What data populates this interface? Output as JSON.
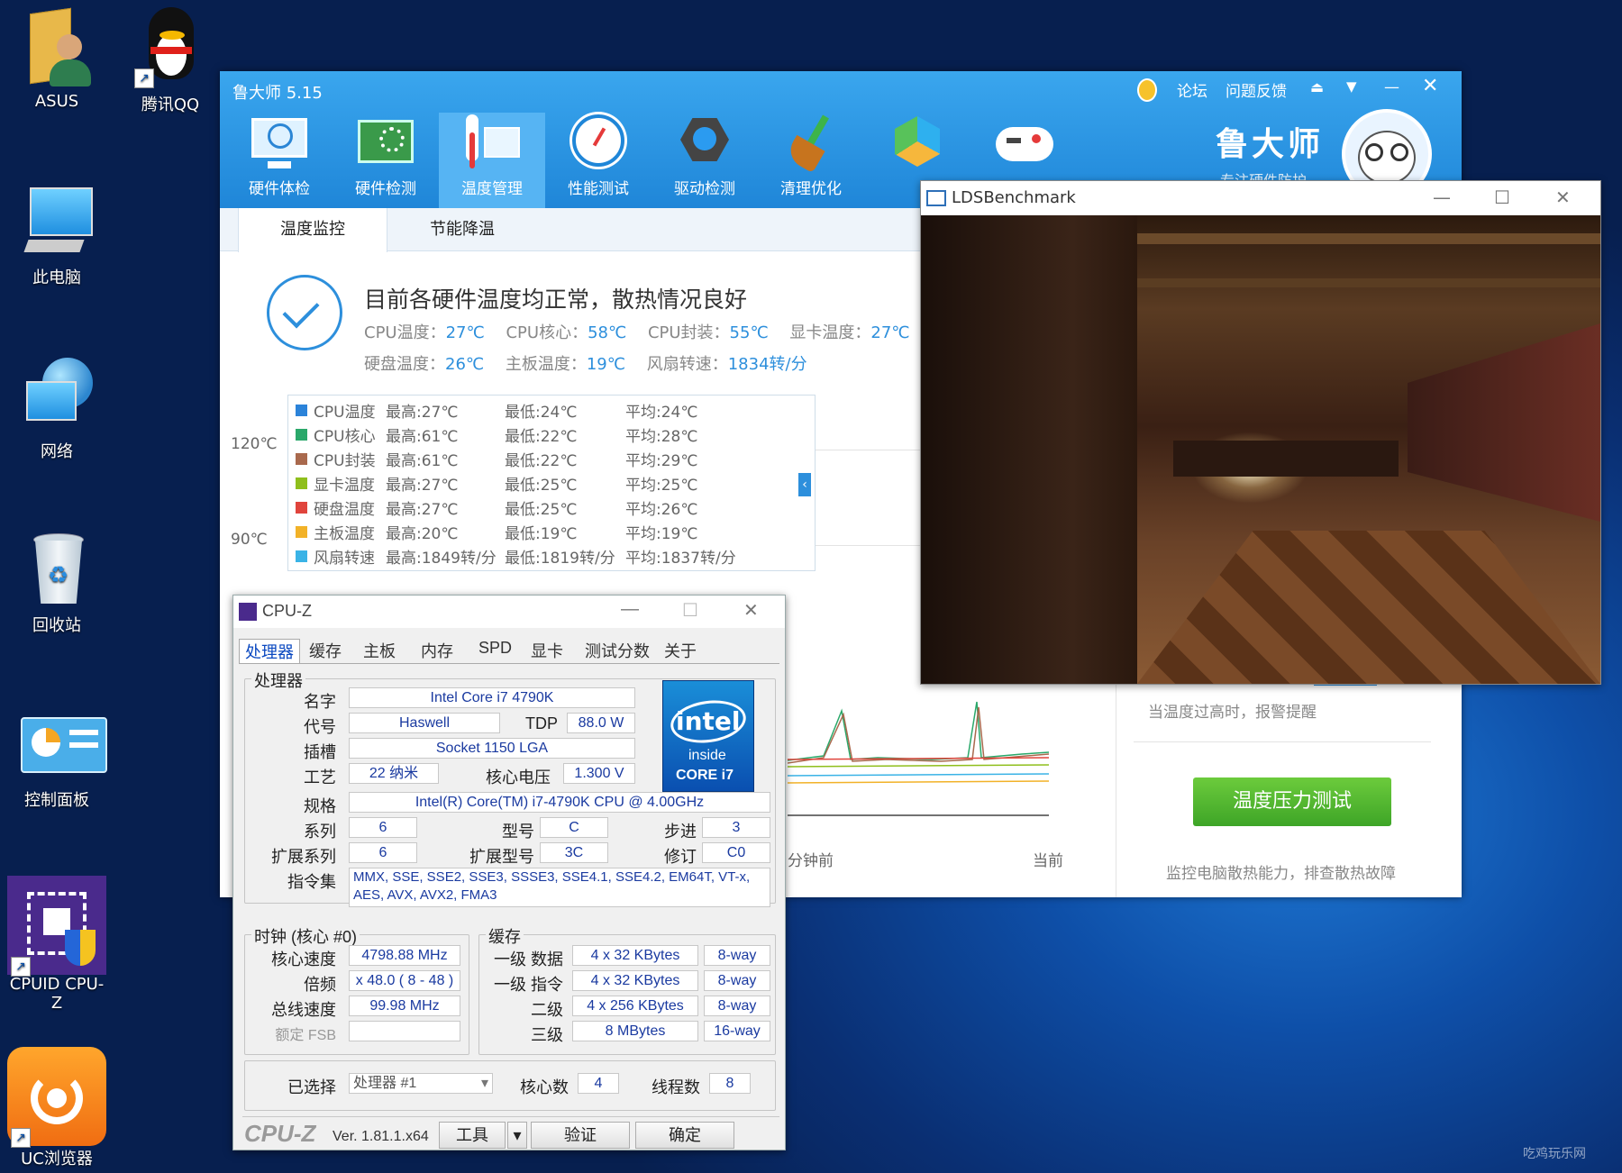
{
  "desktop": {
    "icons": [
      {
        "label": "ASUS",
        "icon": "user-folder-icon"
      },
      {
        "label": "腾讯QQ",
        "icon": "qq-penguin-icon"
      },
      {
        "label": "此电脑",
        "icon": "computer-icon"
      },
      {
        "label": "网络",
        "icon": "network-globe-icon"
      },
      {
        "label": "回收站",
        "icon": "recycle-bin-icon"
      },
      {
        "label": "控制面板",
        "icon": "control-panel-icon"
      },
      {
        "label": "CPUID CPU-Z",
        "icon": "cpu-chip-icon"
      },
      {
        "label": "UC浏览器",
        "icon": "uc-browser-icon"
      }
    ],
    "watermark": "吃鸡玩乐网"
  },
  "ludashi": {
    "title": "鲁大师 5.15",
    "top_links": [
      "论坛",
      "问题反馈"
    ],
    "nav": [
      {
        "label": "硬件体检",
        "icon": "monitor-check-icon"
      },
      {
        "label": "硬件检测",
        "icon": "hardware-board-icon"
      },
      {
        "label": "温度管理",
        "icon": "thermometer-icon"
      },
      {
        "label": "性能测试",
        "icon": "speedometer-icon"
      },
      {
        "label": "驱动检测",
        "icon": "gear-driver-icon"
      },
      {
        "label": "清理优化",
        "icon": "broom-icon"
      },
      {
        "label": "",
        "icon": "cube-icon"
      },
      {
        "label": "",
        "icon": "gamepad-icon"
      }
    ],
    "brand": "鲁大师",
    "brand_sub": "专注硬件防护",
    "subtabs": [
      "温度监控",
      "节能降温"
    ],
    "status_title": "目前各硬件温度均正常，散热情况良好",
    "metrics_row1": [
      {
        "label": "CPU温度：",
        "value": "27℃"
      },
      {
        "label": "CPU核心：",
        "value": "58℃"
      },
      {
        "label": "CPU封装：",
        "value": "55℃"
      },
      {
        "label": "显卡温度：",
        "value": "27℃"
      }
    ],
    "metrics_row2": [
      {
        "label": "硬盘温度：",
        "value": "26℃"
      },
      {
        "label": "主板温度：",
        "value": "19℃"
      },
      {
        "label": "风扇转速：",
        "value": "1834转/分"
      }
    ],
    "y_axis": [
      "120℃",
      "90℃"
    ],
    "legend": [
      {
        "name": "CPU温度",
        "max": "最高:27℃",
        "min": "最低:24℃",
        "avg": "平均:24℃",
        "color": "#2b83d9"
      },
      {
        "name": "CPU核心",
        "max": "最高:61℃",
        "min": "最低:22℃",
        "avg": "平均:28℃",
        "color": "#2aa86a"
      },
      {
        "name": "CPU封装",
        "max": "最高:61℃",
        "min": "最低:22℃",
        "avg": "平均:29℃",
        "color": "#a9694d"
      },
      {
        "name": "显卡温度",
        "max": "最高:27℃",
        "min": "最低:25℃",
        "avg": "平均:25℃",
        "color": "#8fbf1c"
      },
      {
        "name": "硬盘温度",
        "max": "最高:27℃",
        "min": "最低:25℃",
        "avg": "平均:26℃",
        "color": "#e0443c"
      },
      {
        "name": "主板温度",
        "max": "最高:20℃",
        "min": "最低:19℃",
        "avg": "平均:19℃",
        "color": "#f2b228"
      },
      {
        "name": "风扇转速",
        "max": "最高:1849转/分",
        "min": "最低:1819转/分",
        "avg": "平均:1837转/分",
        "color": "#3ab3e6"
      }
    ],
    "x_axis": [
      "分钟前",
      "当前"
    ],
    "alert_text": "当温度过高时，报警提醒",
    "stress_button": "温度压力测试",
    "stress_hint": "监控电脑散热能力，排查散热故障"
  },
  "bench": {
    "title": "LDSBenchmark"
  },
  "cpuz": {
    "title": "CPU-Z",
    "tabs": [
      "处理器",
      "缓存",
      "主板",
      "内存",
      "SPD",
      "显卡",
      "测试分数",
      "关于"
    ],
    "processor_group": "处理器",
    "labels": {
      "name": "名字",
      "code": "代号",
      "tdp": "TDP",
      "socket": "插槽",
      "tech": "工艺",
      "voltage": "核心电压",
      "spec": "规格",
      "family": "系列",
      "model": "型号",
      "stepping": "步进",
      "ext_family": "扩展系列",
      "ext_model": "扩展型号",
      "revision": "修订",
      "instructions": "指令集"
    },
    "values": {
      "name": "Intel Core i7 4790K",
      "code": "Haswell",
      "tdp": "88.0 W",
      "socket": "Socket 1150 LGA",
      "tech": "22 纳米",
      "voltage": "1.300 V",
      "spec": "Intel(R) Core(TM) i7-4790K CPU @ 4.00GHz",
      "family": "6",
      "model": "C",
      "stepping": "3",
      "ext_family": "6",
      "ext_model": "3C",
      "revision": "C0",
      "instructions_1": "MMX, SSE, SSE2, SSE3, SSSE3, SSE4.1, SSE4.2, EM64T, VT-x,",
      "instructions_2": "AES, AVX, AVX2, FMA3"
    },
    "intel_logo": {
      "brand": "intel",
      "inside": "inside",
      "line": "CORE i7"
    },
    "clock_group": "时钟 (核心 #0)",
    "clock_labels": [
      "核心速度",
      "倍频",
      "总线速度",
      "额定 FSB"
    ],
    "clock_values": [
      "4798.88 MHz",
      "x 48.0 ( 8 - 48 )",
      "99.98 MHz",
      ""
    ],
    "cache_group": "缓存",
    "cache_rows": [
      {
        "label": "一级 数据",
        "size": "4 x 32 KBytes",
        "way": "8-way"
      },
      {
        "label": "一级 指令",
        "size": "4 x 32 KBytes",
        "way": "8-way"
      },
      {
        "label": "二级",
        "size": "4 x 256 KBytes",
        "way": "8-way"
      },
      {
        "label": "三级",
        "size": "8 MBytes",
        "way": "16-way"
      }
    ],
    "selected_label": "已选择",
    "selected_value": "处理器 #1",
    "cores_label": "核心数",
    "cores_value": "4",
    "threads_label": "线程数",
    "threads_value": "8",
    "footer_logo": "CPU-Z",
    "version": "Ver. 1.81.1.x64",
    "buttons": [
      "工具",
      "验证",
      "确定"
    ]
  }
}
